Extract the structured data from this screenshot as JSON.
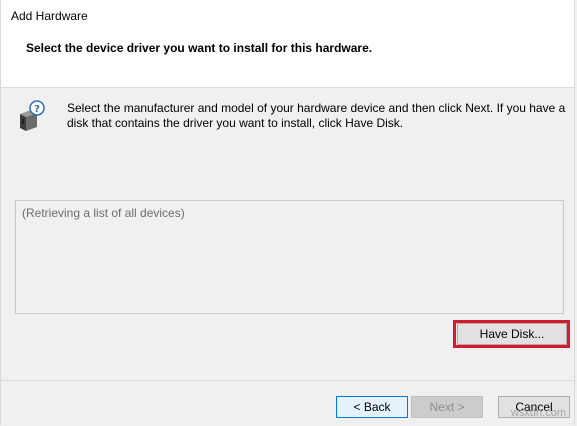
{
  "window": {
    "title": "Add Hardware"
  },
  "header": {
    "subtitle": "Select the device driver you want to install for this hardware."
  },
  "instructions": {
    "icon": "hardware-device-help-icon",
    "text": "Select the manufacturer and model of your hardware device and then click Next. If you have a disk that contains the driver you want to install, click Have Disk."
  },
  "device_list": {
    "status_text": "(Retrieving a list of all devices)"
  },
  "buttons": {
    "have_disk": "Have Disk...",
    "back": "< Back",
    "next": "Next >",
    "cancel": "Cancel"
  },
  "watermark": {
    "text": "wsxdn.com"
  },
  "colors": {
    "highlight": "#d8182c",
    "focus_border": "#0078d7",
    "header_bg": "#ffffff",
    "dialog_bg": "#f0f0f0"
  }
}
